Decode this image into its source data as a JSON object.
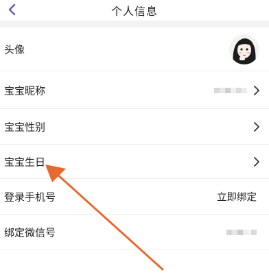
{
  "header": {
    "title": "个人信息",
    "back_icon": "back-chevron-icon"
  },
  "rows": {
    "avatar": {
      "label": "头像"
    },
    "nickname": {
      "label": "宝宝昵称"
    },
    "gender": {
      "label": "宝宝性别"
    },
    "birthday": {
      "label": "宝宝生日"
    },
    "phone": {
      "label": "登录手机号",
      "action": "立即绑定"
    },
    "wechat": {
      "label": "绑定微信号"
    }
  },
  "colors": {
    "accent": "#6b5bb8",
    "annotation_arrow": "#e8692e",
    "band": "#f3f3f5"
  }
}
